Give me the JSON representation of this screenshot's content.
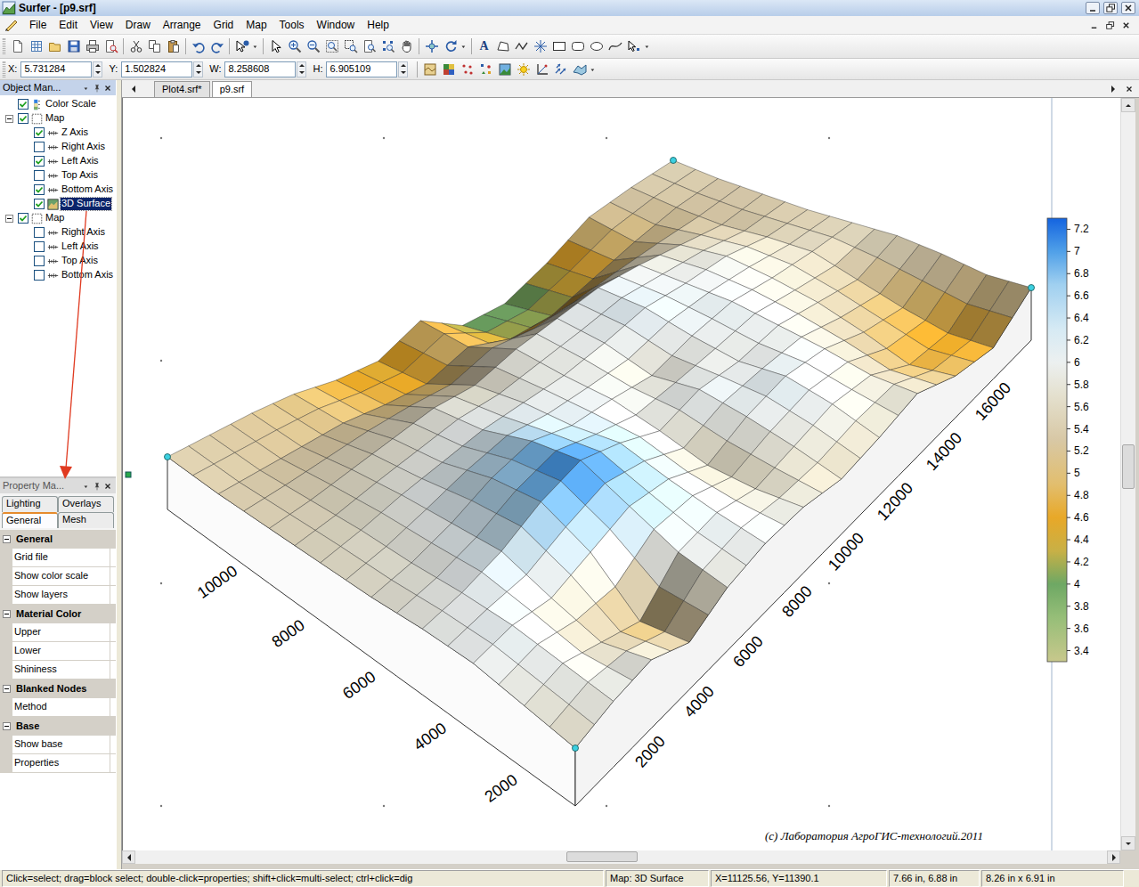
{
  "window": {
    "title": "Surfer - [p9.srf]"
  },
  "menu": [
    "File",
    "Edit",
    "View",
    "Draw",
    "Arrange",
    "Grid",
    "Map",
    "Tools",
    "Window",
    "Help"
  ],
  "toolbar": {
    "text_tool": "A"
  },
  "position_fields": [
    {
      "label": "X:",
      "value": "5.731284"
    },
    {
      "label": "Y:",
      "value": "1.502824"
    },
    {
      "label": "W:",
      "value": "8.258608"
    },
    {
      "label": "H:",
      "value": "6.905109"
    }
  ],
  "object_manager": {
    "title": "Object Man...",
    "items": [
      {
        "label": "Color Scale",
        "depth": 0,
        "kind": "color-scale",
        "has_children": false,
        "expanded": false,
        "checked": true,
        "selected": false
      },
      {
        "label": "Map",
        "depth": 0,
        "kind": "map",
        "has_children": true,
        "expanded": true,
        "checked": true,
        "selected": false
      },
      {
        "label": "Z Axis",
        "depth": 1,
        "kind": "axis",
        "has_children": false,
        "expanded": false,
        "checked": true,
        "selected": false
      },
      {
        "label": "Right Axis",
        "depth": 1,
        "kind": "axis",
        "has_children": false,
        "expanded": false,
        "checked": false,
        "selected": false
      },
      {
        "label": "Left Axis",
        "depth": 1,
        "kind": "axis",
        "has_children": false,
        "expanded": false,
        "checked": true,
        "selected": false
      },
      {
        "label": "Top Axis",
        "depth": 1,
        "kind": "axis",
        "has_children": false,
        "expanded": false,
        "checked": false,
        "selected": false
      },
      {
        "label": "Bottom Axis",
        "depth": 1,
        "kind": "axis",
        "has_children": false,
        "expanded": false,
        "checked": true,
        "selected": false
      },
      {
        "label": "3D Surface",
        "depth": 1,
        "kind": "surface",
        "has_children": false,
        "expanded": false,
        "checked": true,
        "selected": true
      },
      {
        "label": "Map",
        "depth": 0,
        "kind": "map",
        "has_children": true,
        "expanded": true,
        "checked": true,
        "selected": false
      },
      {
        "label": "Right Axis",
        "depth": 1,
        "kind": "axis",
        "has_children": false,
        "expanded": false,
        "checked": false,
        "selected": false
      },
      {
        "label": "Left Axis",
        "depth": 1,
        "kind": "axis",
        "has_children": false,
        "expanded": false,
        "checked": false,
        "selected": false
      },
      {
        "label": "Top Axis",
        "depth": 1,
        "kind": "axis",
        "has_children": false,
        "expanded": false,
        "checked": false,
        "selected": false
      },
      {
        "label": "Bottom Axis",
        "depth": 1,
        "kind": "axis",
        "has_children": false,
        "expanded": false,
        "checked": false,
        "selected": false
      }
    ]
  },
  "property_manager": {
    "title": "Property Ma...",
    "tabs": [
      {
        "label": "Lighting",
        "selected": false
      },
      {
        "label": "Overlays",
        "selected": false
      },
      {
        "label": "General",
        "selected": true
      },
      {
        "label": "Mesh",
        "selected": false
      }
    ],
    "sections": [
      {
        "title": "General",
        "expanded": true,
        "rows": [
          "Grid file",
          "Show color scale",
          "Show layers"
        ]
      },
      {
        "title": "Material Color",
        "expanded": true,
        "rows": [
          "Upper",
          "Lower",
          "Shininess"
        ]
      },
      {
        "title": "Blanked Nodes",
        "expanded": true,
        "rows": [
          "Method"
        ]
      },
      {
        "title": "Base",
        "expanded": true,
        "rows": [
          "Show base",
          "Properties"
        ]
      }
    ]
  },
  "document_tabs": [
    {
      "label": "Plot4.srf*",
      "selected": false
    },
    {
      "label": "p9.srf",
      "selected": true
    }
  ],
  "canvas": {
    "surface": {
      "z": [
        [
          5.6,
          5.9,
          6.0,
          5.2,
          5.8,
          6.0,
          5.9,
          5.5,
          5.6,
          5.8,
          5.0,
          4.6,
          5.4
        ],
        [
          5.8,
          6.0,
          5.4,
          4.8,
          6.0,
          6.1,
          5.6,
          5.8,
          6.0,
          5.7,
          4.7,
          4.5,
          5.3
        ],
        [
          6.0,
          6.1,
          5.8,
          6.2,
          6.6,
          6.3,
          5.5,
          6.0,
          6.2,
          5.9,
          5.2,
          4.8,
          5.5
        ],
        [
          5.9,
          6.0,
          6.3,
          6.9,
          7.2,
          6.6,
          5.8,
          6.1,
          5.9,
          6.0,
          5.6,
          5.2,
          5.6
        ],
        [
          5.7,
          5.8,
          6.1,
          6.6,
          6.8,
          6.2,
          6.0,
          5.7,
          6.0,
          6.1,
          5.8,
          5.6,
          5.5
        ],
        [
          5.6,
          5.7,
          5.9,
          6.0,
          6.1,
          6.0,
          5.9,
          6.0,
          6.2,
          6.0,
          5.9,
          5.5,
          5.4
        ],
        [
          5.5,
          5.5,
          5.6,
          5.7,
          5.8,
          5.6,
          5.9,
          6.0,
          6.1,
          5.9,
          5.6,
          5.3,
          5.4
        ],
        [
          5.4,
          5.3,
          5.2,
          5.1,
          4.8,
          4.6,
          5.0,
          4.3,
          4.2,
          4.6,
          5.0,
          5.3,
          5.4
        ],
        [
          5.4,
          5.3,
          5.2,
          5.0,
          4.6,
          4.4,
          5.0,
          3.9,
          3.8,
          4.4,
          5.2,
          5.4,
          5.5
        ]
      ]
    },
    "color_scale": {
      "labels": [
        "7.2",
        "7",
        "6.8",
        "6.6",
        "6.4",
        "6.2",
        "6",
        "5.8",
        "5.6",
        "5.4",
        "5.2",
        "5",
        "4.8",
        "4.6",
        "4.4",
        "4.2",
        "4",
        "3.8",
        "3.6",
        "3.4"
      ]
    },
    "left_axis": {
      "labels": [
        "10000",
        "8000",
        "6000",
        "4000",
        "2000"
      ]
    },
    "bottom_axis": {
      "labels": [
        "2000",
        "4000",
        "6000",
        "8000",
        "10000",
        "12000",
        "14000",
        "16000"
      ]
    },
    "watermark": "(c) Лаборатория АгроГИС-технологий.2011"
  },
  "scrollbars": {
    "vertical": {
      "level": 0.49
    },
    "horizontal": {
      "level": 0.48
    }
  },
  "status_bar": [
    "Click=select; drag=block select; double-click=properties; shift+click=multi-select; ctrl+click=dig",
    "Map: 3D Surface",
    "X=11125.56, Y=11390.1",
    "7.66 in, 6.88 in",
    "8.26 in x 6.91 in"
  ]
}
